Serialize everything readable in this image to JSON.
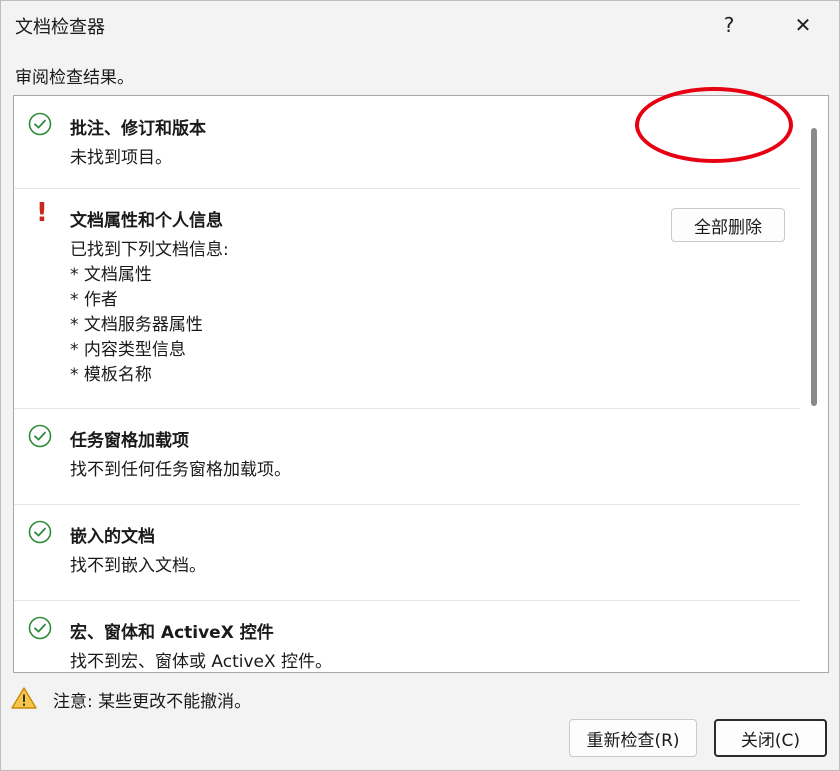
{
  "window": {
    "title": "文档检查器",
    "help_label": "?",
    "close_label": "✕"
  },
  "subtitle": "审阅检查结果。",
  "sections": [
    {
      "title": "批注、修订和版本",
      "status": "ok",
      "lines": [
        "未找到项目。"
      ]
    },
    {
      "title": "文档属性和个人信息",
      "status": "found",
      "lines": [
        "已找到下列文档信息:",
        "* 文档属性",
        "* 作者",
        "* 文档服务器属性",
        "* 内容类型信息",
        "* 模板名称"
      ],
      "button_label": "全部删除"
    },
    {
      "title": "任务窗格加载项",
      "status": "ok",
      "lines": [
        "找不到任何任务窗格加载项。"
      ]
    },
    {
      "title": "嵌入的文档",
      "status": "ok",
      "lines": [
        "找不到嵌入文档。"
      ]
    },
    {
      "title": "宏、窗体和 ActiveX 控件",
      "status": "ok",
      "lines": [
        "找不到宏、窗体或 ActiveX 控件。"
      ]
    }
  ],
  "footer": {
    "warning": "注意: 某些更改不能撤消。",
    "reinspect_label": "重新检查(R)",
    "close_label": "关闭(C)"
  },
  "colors": {
    "check": "#2e8b3d",
    "alert": "#c42b1c",
    "highlight": "#e60012",
    "warning": "#e8a317"
  }
}
